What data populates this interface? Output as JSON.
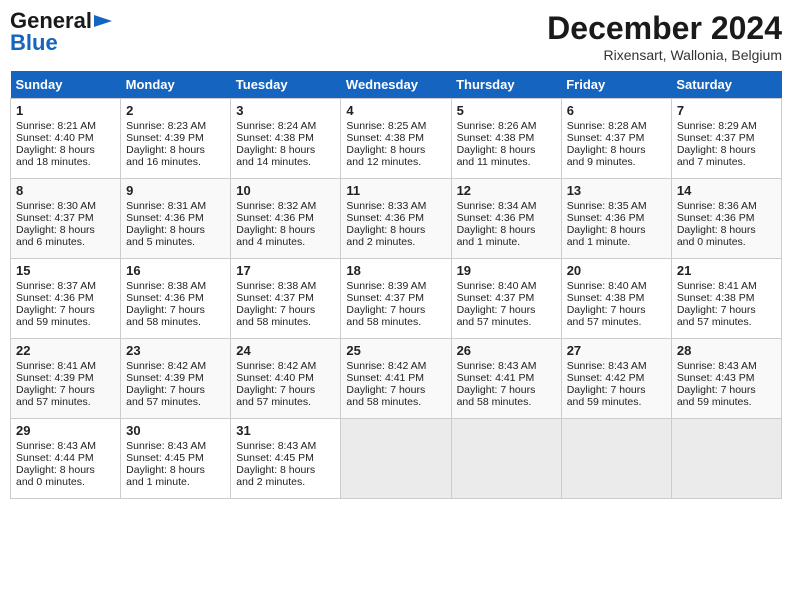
{
  "header": {
    "logo_general": "General",
    "logo_blue": "Blue",
    "month_title": "December 2024",
    "location": "Rixensart, Wallonia, Belgium"
  },
  "days_of_week": [
    "Sunday",
    "Monday",
    "Tuesday",
    "Wednesday",
    "Thursday",
    "Friday",
    "Saturday"
  ],
  "weeks": [
    [
      {
        "day": 1,
        "lines": [
          "Sunrise: 8:21 AM",
          "Sunset: 4:40 PM",
          "Daylight: 8 hours",
          "and 18 minutes."
        ]
      },
      {
        "day": 2,
        "lines": [
          "Sunrise: 8:23 AM",
          "Sunset: 4:39 PM",
          "Daylight: 8 hours",
          "and 16 minutes."
        ]
      },
      {
        "day": 3,
        "lines": [
          "Sunrise: 8:24 AM",
          "Sunset: 4:38 PM",
          "Daylight: 8 hours",
          "and 14 minutes."
        ]
      },
      {
        "day": 4,
        "lines": [
          "Sunrise: 8:25 AM",
          "Sunset: 4:38 PM",
          "Daylight: 8 hours",
          "and 12 minutes."
        ]
      },
      {
        "day": 5,
        "lines": [
          "Sunrise: 8:26 AM",
          "Sunset: 4:38 PM",
          "Daylight: 8 hours",
          "and 11 minutes."
        ]
      },
      {
        "day": 6,
        "lines": [
          "Sunrise: 8:28 AM",
          "Sunset: 4:37 PM",
          "Daylight: 8 hours",
          "and 9 minutes."
        ]
      },
      {
        "day": 7,
        "lines": [
          "Sunrise: 8:29 AM",
          "Sunset: 4:37 PM",
          "Daylight: 8 hours",
          "and 7 minutes."
        ]
      }
    ],
    [
      {
        "day": 8,
        "lines": [
          "Sunrise: 8:30 AM",
          "Sunset: 4:37 PM",
          "Daylight: 8 hours",
          "and 6 minutes."
        ]
      },
      {
        "day": 9,
        "lines": [
          "Sunrise: 8:31 AM",
          "Sunset: 4:36 PM",
          "Daylight: 8 hours",
          "and 5 minutes."
        ]
      },
      {
        "day": 10,
        "lines": [
          "Sunrise: 8:32 AM",
          "Sunset: 4:36 PM",
          "Daylight: 8 hours",
          "and 4 minutes."
        ]
      },
      {
        "day": 11,
        "lines": [
          "Sunrise: 8:33 AM",
          "Sunset: 4:36 PM",
          "Daylight: 8 hours",
          "and 2 minutes."
        ]
      },
      {
        "day": 12,
        "lines": [
          "Sunrise: 8:34 AM",
          "Sunset: 4:36 PM",
          "Daylight: 8 hours",
          "and 1 minute."
        ]
      },
      {
        "day": 13,
        "lines": [
          "Sunrise: 8:35 AM",
          "Sunset: 4:36 PM",
          "Daylight: 8 hours",
          "and 1 minute."
        ]
      },
      {
        "day": 14,
        "lines": [
          "Sunrise: 8:36 AM",
          "Sunset: 4:36 PM",
          "Daylight: 8 hours",
          "and 0 minutes."
        ]
      }
    ],
    [
      {
        "day": 15,
        "lines": [
          "Sunrise: 8:37 AM",
          "Sunset: 4:36 PM",
          "Daylight: 7 hours",
          "and 59 minutes."
        ]
      },
      {
        "day": 16,
        "lines": [
          "Sunrise: 8:38 AM",
          "Sunset: 4:36 PM",
          "Daylight: 7 hours",
          "and 58 minutes."
        ]
      },
      {
        "day": 17,
        "lines": [
          "Sunrise: 8:38 AM",
          "Sunset: 4:37 PM",
          "Daylight: 7 hours",
          "and 58 minutes."
        ]
      },
      {
        "day": 18,
        "lines": [
          "Sunrise: 8:39 AM",
          "Sunset: 4:37 PM",
          "Daylight: 7 hours",
          "and 58 minutes."
        ]
      },
      {
        "day": 19,
        "lines": [
          "Sunrise: 8:40 AM",
          "Sunset: 4:37 PM",
          "Daylight: 7 hours",
          "and 57 minutes."
        ]
      },
      {
        "day": 20,
        "lines": [
          "Sunrise: 8:40 AM",
          "Sunset: 4:38 PM",
          "Daylight: 7 hours",
          "and 57 minutes."
        ]
      },
      {
        "day": 21,
        "lines": [
          "Sunrise: 8:41 AM",
          "Sunset: 4:38 PM",
          "Daylight: 7 hours",
          "and 57 minutes."
        ]
      }
    ],
    [
      {
        "day": 22,
        "lines": [
          "Sunrise: 8:41 AM",
          "Sunset: 4:39 PM",
          "Daylight: 7 hours",
          "and 57 minutes."
        ]
      },
      {
        "day": 23,
        "lines": [
          "Sunrise: 8:42 AM",
          "Sunset: 4:39 PM",
          "Daylight: 7 hours",
          "and 57 minutes."
        ]
      },
      {
        "day": 24,
        "lines": [
          "Sunrise: 8:42 AM",
          "Sunset: 4:40 PM",
          "Daylight: 7 hours",
          "and 57 minutes."
        ]
      },
      {
        "day": 25,
        "lines": [
          "Sunrise: 8:42 AM",
          "Sunset: 4:41 PM",
          "Daylight: 7 hours",
          "and 58 minutes."
        ]
      },
      {
        "day": 26,
        "lines": [
          "Sunrise: 8:43 AM",
          "Sunset: 4:41 PM",
          "Daylight: 7 hours",
          "and 58 minutes."
        ]
      },
      {
        "day": 27,
        "lines": [
          "Sunrise: 8:43 AM",
          "Sunset: 4:42 PM",
          "Daylight: 7 hours",
          "and 59 minutes."
        ]
      },
      {
        "day": 28,
        "lines": [
          "Sunrise: 8:43 AM",
          "Sunset: 4:43 PM",
          "Daylight: 7 hours",
          "and 59 minutes."
        ]
      }
    ],
    [
      {
        "day": 29,
        "lines": [
          "Sunrise: 8:43 AM",
          "Sunset: 4:44 PM",
          "Daylight: 8 hours",
          "and 0 minutes."
        ]
      },
      {
        "day": 30,
        "lines": [
          "Sunrise: 8:43 AM",
          "Sunset: 4:45 PM",
          "Daylight: 8 hours",
          "and 1 minute."
        ]
      },
      {
        "day": 31,
        "lines": [
          "Sunrise: 8:43 AM",
          "Sunset: 4:45 PM",
          "Daylight: 8 hours",
          "and 2 minutes."
        ]
      },
      null,
      null,
      null,
      null
    ]
  ]
}
